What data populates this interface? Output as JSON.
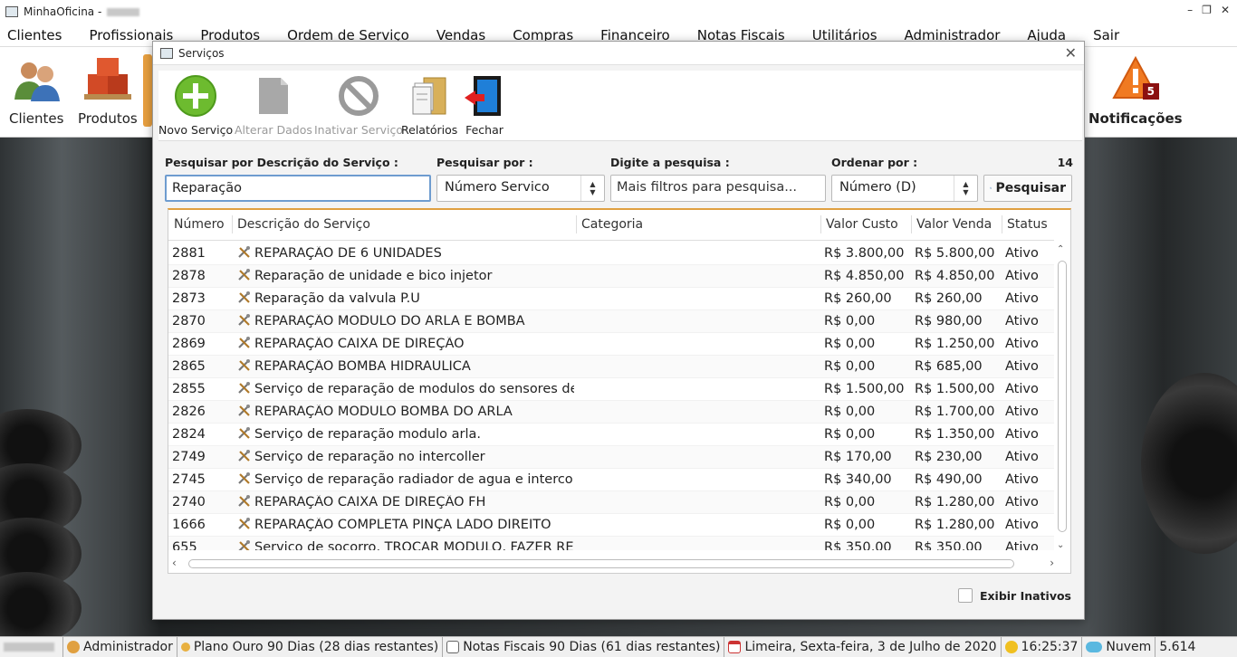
{
  "window": {
    "title": "MinhaOficina -"
  },
  "menu": [
    "Clientes",
    "Profissionais",
    "Produtos",
    "Ordem de Serviço",
    "Vendas",
    "Compras",
    "Financeiro",
    "Notas Fiscais",
    "Utilitários",
    "Administrador",
    "Ajuda",
    "Sair"
  ],
  "main_toolbar": {
    "clientes": "Clientes",
    "produtos": "Produtos",
    "notificacoes": "Notificações",
    "notif_count": "5"
  },
  "dialog": {
    "title": "Serviços",
    "toolbar": {
      "novo": "Novo Serviço",
      "alterar": "Alterar Dados",
      "inativar": "Inativar Serviço",
      "relatorios": "Relatórios",
      "fechar": "Fechar"
    },
    "search": {
      "desc_label": "Pesquisar por Descrição do Serviço :",
      "desc_value": "Reparação",
      "by_label": "Pesquisar por :",
      "by_value": "Número Servico",
      "type_label": "Digite a pesquisa :",
      "type_placeholder": "Mais filtros para pesquisa...",
      "order_label": "Ordenar por :",
      "order_value": "Número (D)",
      "button": "Pesquisar",
      "count": "14"
    },
    "table": {
      "columns": [
        "Número",
        "Descrição do Serviço",
        "Categoria",
        "Valor Custo",
        "Valor Venda",
        "Status"
      ],
      "rows": [
        [
          "2881",
          "REPARAÇÃO DE 6 UNIDADES",
          "",
          "R$ 3.800,00",
          "R$ 5.800,00",
          "Ativo"
        ],
        [
          "2878",
          "Reparação de unidade e bico injetor",
          "",
          "R$ 4.850,00",
          "R$ 4.850,00",
          "Ativo"
        ],
        [
          "2873",
          "Reparação da valvula P.U",
          "",
          "R$ 260,00",
          "R$ 260,00",
          "Ativo"
        ],
        [
          "2870",
          "REPARAÇÃO MODULO DO ARLA E BOMBA",
          "",
          "R$ 0,00",
          "R$ 980,00",
          "Ativo"
        ],
        [
          "2869",
          "REPARAÇÃO CAIXA DE DIREÇÃO",
          "",
          "R$ 0,00",
          "R$ 1.250,00",
          "Ativo"
        ],
        [
          "2865",
          "REPARAÇÃO BOMBA HIDRAULICA",
          "",
          "R$ 0,00",
          "R$ 685,00",
          "Ativo"
        ],
        [
          "2855",
          "Serviço de reparação de modulos do sensores de ro...",
          "",
          "R$ 1.500,00",
          "R$ 1.500,00",
          "Ativo"
        ],
        [
          "2826",
          "REPARAÇÃO MODULO BOMBA DO ARLA",
          "",
          "R$ 0,00",
          "R$ 1.700,00",
          "Ativo"
        ],
        [
          "2824",
          "Serviço de reparação modulo arla.",
          "",
          "R$ 0,00",
          "R$ 1.350,00",
          "Ativo"
        ],
        [
          "2749",
          "Serviço de reparação no intercoller",
          "",
          "R$ 170,00",
          "R$ 230,00",
          "Ativo"
        ],
        [
          "2745",
          "Serviço de reparação radiador de agua e intercoller",
          "",
          "R$ 340,00",
          "R$ 490,00",
          "Ativo"
        ],
        [
          "2740",
          "REPARAÇÃO CAIXA DE DIREÇÃO FH",
          "",
          "R$ 0,00",
          "R$ 1.280,00",
          "Ativo"
        ],
        [
          "1666",
          "REPARAÇÃO COMPLETA PINÇA LADO DIREITO",
          "",
          "R$ 0,00",
          "R$ 1.280,00",
          "Ativo"
        ],
        [
          "655",
          "Serviço de socorro, TROCAR MODULO, FAZER REPA...",
          "",
          "R$ 350,00",
          "R$ 350,00",
          "Ativo"
        ]
      ]
    },
    "exibir_inativos": "Exibir Inativos"
  },
  "statusbar": {
    "user": "Administrador",
    "plano": "Plano Ouro 90 Dias (28 dias restantes)",
    "notas": "Notas Fiscais 90 Dias (61 dias restantes)",
    "data": "Limeira, Sexta-feira, 3 de Julho de 2020",
    "hora": "16:25:37",
    "nuvem": "Nuvem",
    "versao": "5.614"
  },
  "colors": {
    "accent": "#e0a040",
    "focus": "#6e9ccf",
    "green": "#6dbb2f",
    "alert": "#e25a1c"
  }
}
